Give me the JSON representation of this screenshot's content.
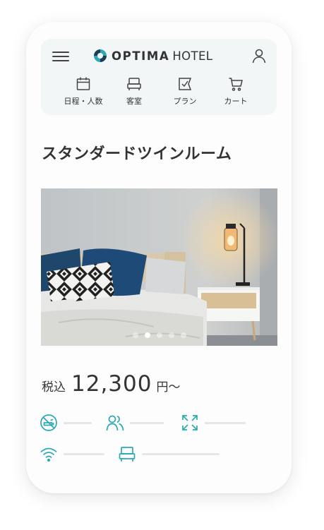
{
  "header": {
    "logo": {
      "brand": "OPTIMA",
      "suffix": "HOTEL"
    },
    "nav": [
      {
        "label": "日程・人数",
        "icon": "calendar-icon"
      },
      {
        "label": "客室",
        "icon": "sofa-icon"
      },
      {
        "label": "プラン",
        "icon": "plan-icon"
      },
      {
        "label": "カート",
        "icon": "cart-icon"
      }
    ]
  },
  "room": {
    "title": "スタンダードツインルーム",
    "carousel": {
      "total": 5,
      "active_index": 1
    },
    "price": {
      "tax_label": "税込",
      "amount": "12,300",
      "unit": "円〜"
    }
  },
  "amenities": [
    {
      "icon": "no-smoking-icon"
    },
    {
      "icon": "guests-icon"
    },
    {
      "icon": "room-size-icon"
    },
    {
      "icon": "wifi-icon"
    },
    {
      "icon": "bed-icon"
    }
  ],
  "colors": {
    "accent": "#2aa9b2",
    "text": "#333333",
    "header_bg": "#f3f6f6",
    "placeholder_bar": "#e4e6e8"
  }
}
